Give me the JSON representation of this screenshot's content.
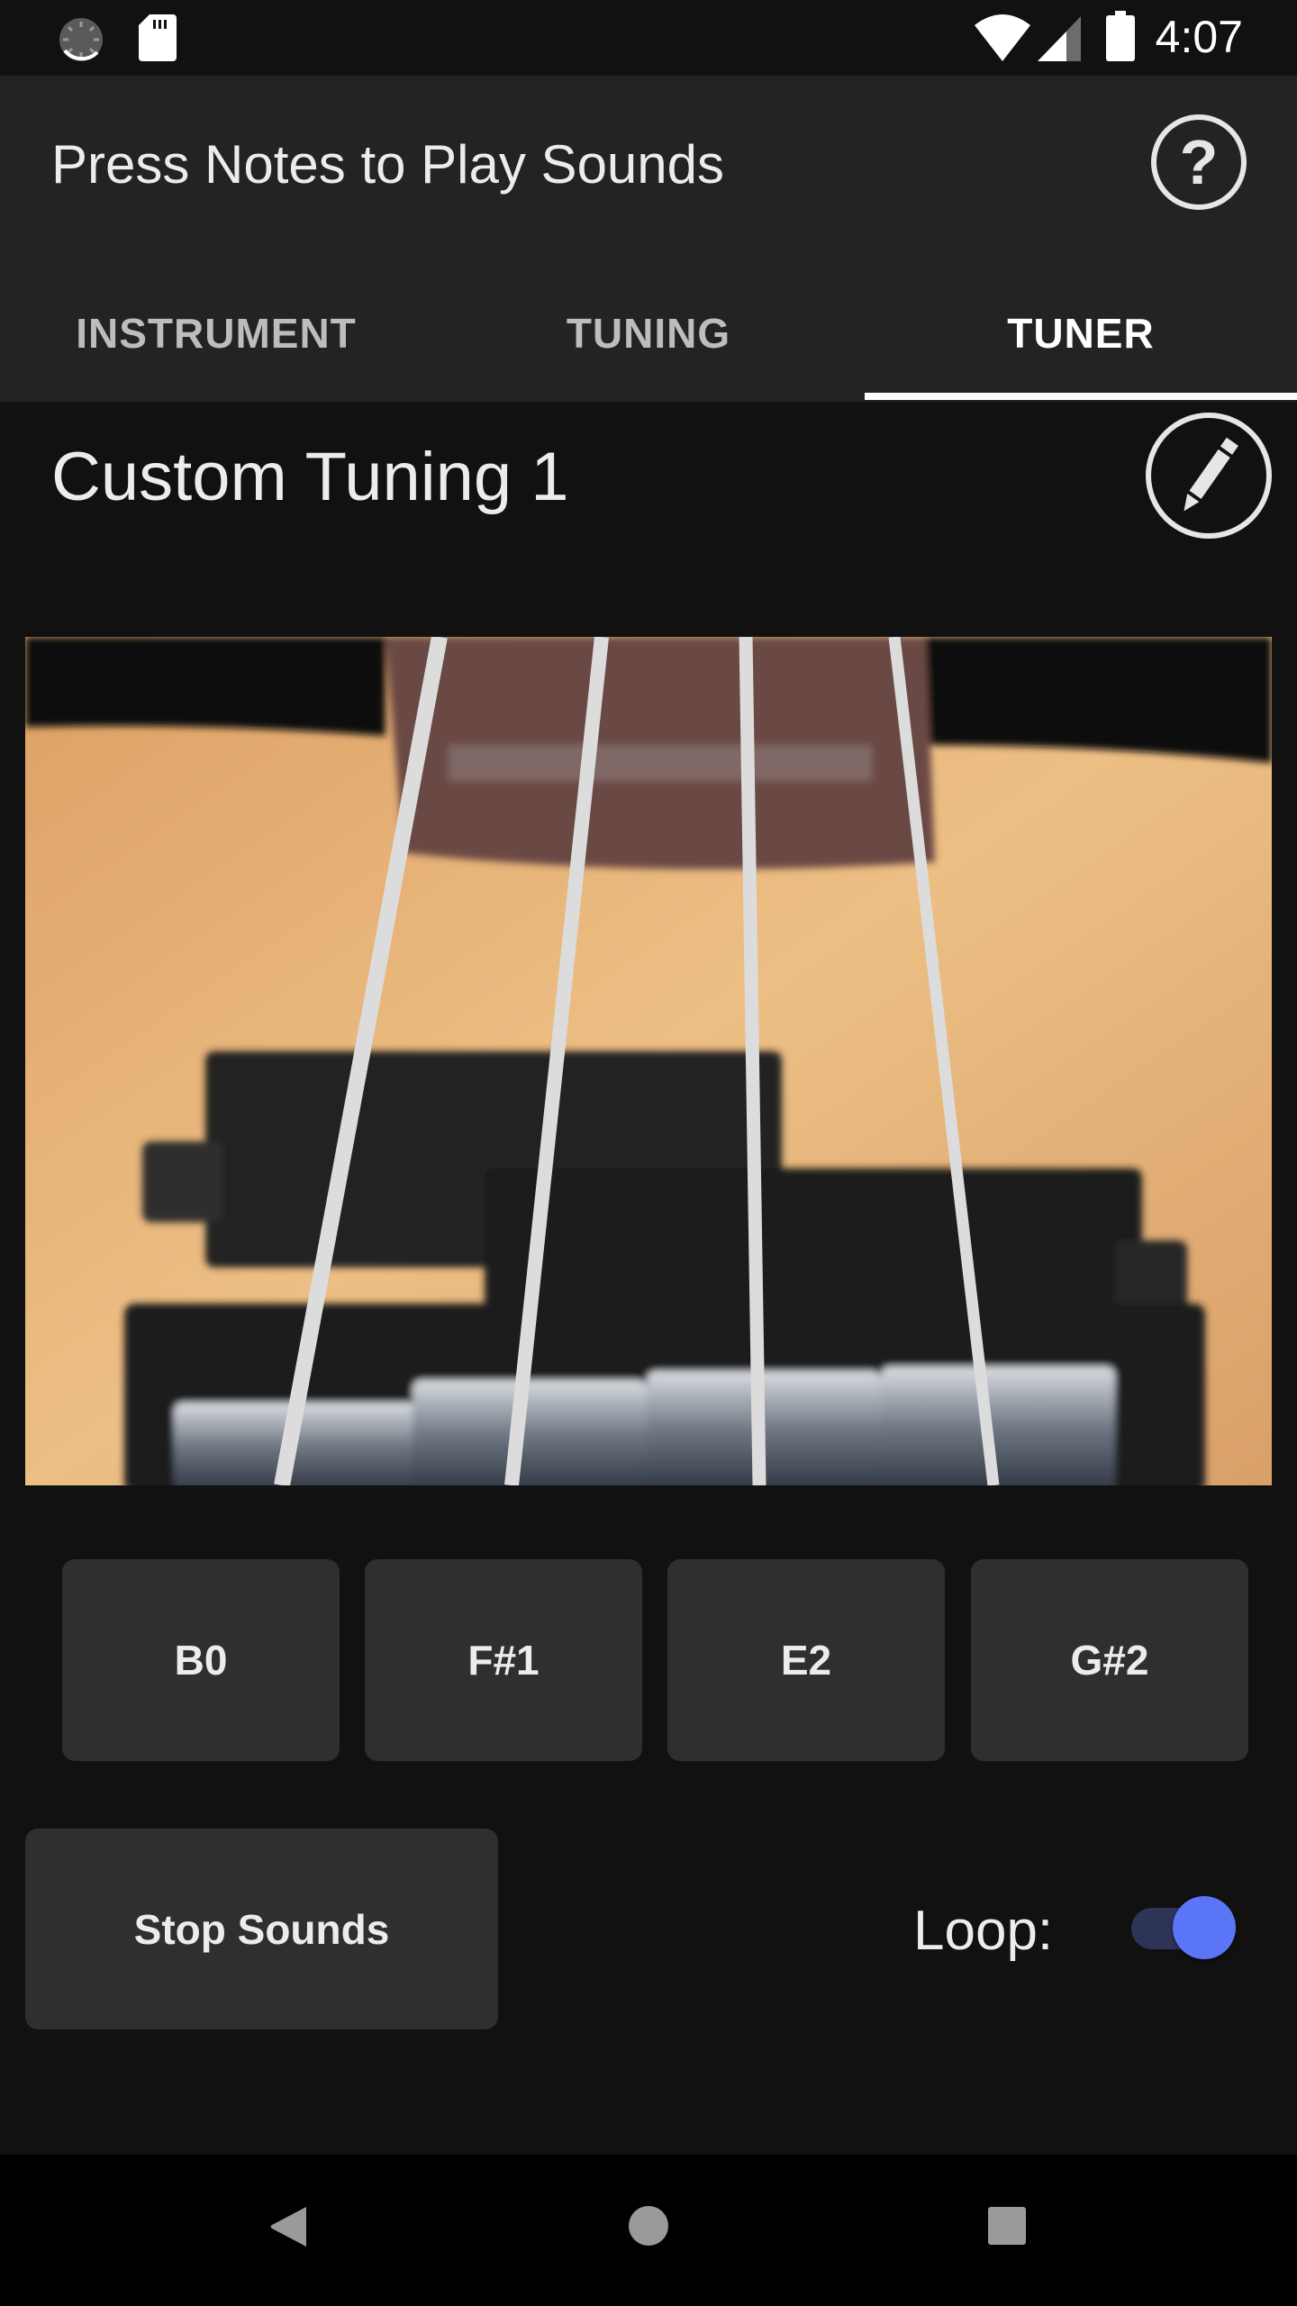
{
  "status_bar": {
    "time": "4:07",
    "left_icons": [
      "sync-icon",
      "sd-card-icon"
    ],
    "right_icons": [
      "wifi-icon",
      "cell-signal-icon",
      "battery-icon"
    ]
  },
  "app_bar": {
    "title": "Press Notes to Play Sounds",
    "help_icon": "help-circle-icon",
    "help_glyph": "?"
  },
  "tabs": [
    {
      "label": "INSTRUMENT",
      "active": false
    },
    {
      "label": "TUNING",
      "active": false
    },
    {
      "label": "TUNER",
      "active": true
    }
  ],
  "tuning": {
    "name": "Custom Tuning 1",
    "edit_icon": "pencil-icon"
  },
  "instrument_image": {
    "subject": "bass guitar strings, pickups and bridge close-up"
  },
  "notes": [
    {
      "label": "B0"
    },
    {
      "label": "F#1"
    },
    {
      "label": "E2"
    },
    {
      "label": "G#2"
    }
  ],
  "controls": {
    "stop_label": "Stop Sounds",
    "loop_label": "Loop:",
    "loop_enabled": true
  },
  "colors": {
    "accent": "#5b75f7",
    "toggle_track": "#2e3358",
    "app_bar": "#232323",
    "background": "#111111",
    "button": "#2f2f2f"
  },
  "nav_bar": {
    "icons": [
      "back-icon",
      "home-icon",
      "recents-icon"
    ]
  }
}
